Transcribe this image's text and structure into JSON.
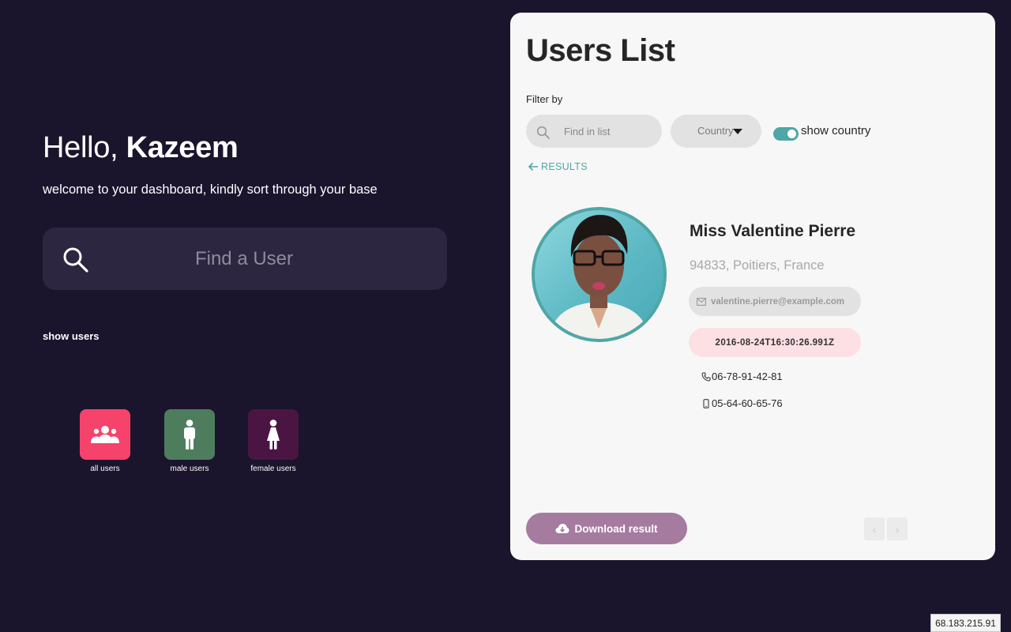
{
  "greeting": {
    "prefix": "Hello, ",
    "name": "Kazeem"
  },
  "subtitle": "welcome to your dashboard, kindly sort through your base",
  "search": {
    "placeholder": "Find a User",
    "icon": "search-icon"
  },
  "show_users_label": "show users",
  "user_filters": [
    {
      "label": "all users",
      "color": "#f5436b",
      "icon": "users-group-icon"
    },
    {
      "label": "male users",
      "color": "#4e7d5d",
      "icon": "male-icon"
    },
    {
      "label": "female users",
      "color": "#4b1543",
      "icon": "female-icon"
    }
  ],
  "panel": {
    "title": "Users List",
    "filter_label": "Filter by",
    "find_placeholder": "Find in list",
    "country_value": "Country",
    "toggle_label": "show country",
    "toggle_on": true,
    "results_label": "RESULTS",
    "accent": "#4fa6a6"
  },
  "user": {
    "name": "Miss Valentine Pierre",
    "location": "94833, Poitiers, France",
    "email": "valentine.pierre@example.com",
    "registered": "2016-08-24T16:30:26.991Z",
    "phone": "06-78-91-42-81",
    "cell": "05-64-60-65-76"
  },
  "download_label": "Download result",
  "pagination": {
    "prev": "‹",
    "next": "›"
  },
  "ip_address": "68.183.215.91"
}
